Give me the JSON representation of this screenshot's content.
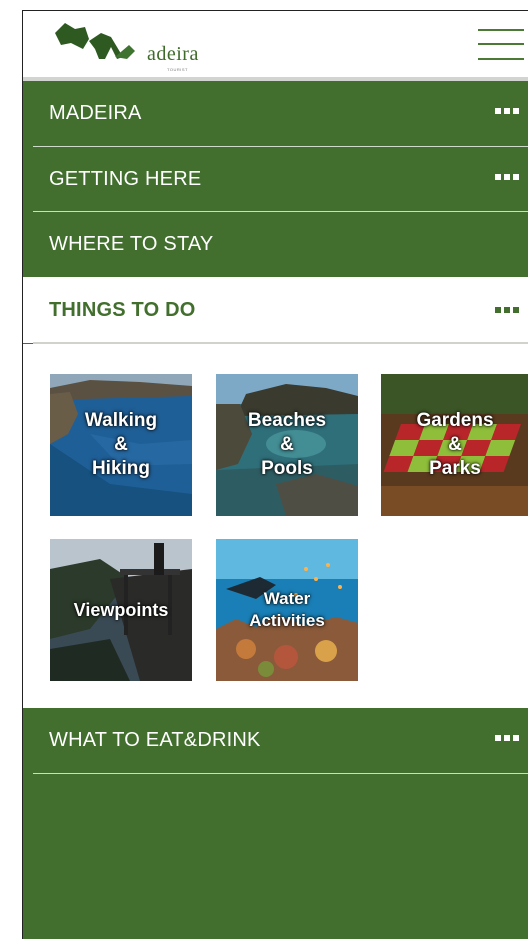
{
  "header": {
    "logo_text": "adeira",
    "logo_subtext": "TOURIST",
    "menu_icon": "hamburger-menu-icon"
  },
  "menu": {
    "madeira": "MADEIRA",
    "getting_here": "GETTING HERE",
    "where_to_stay": "WHERE TO STAY",
    "things_to_do": "THINGS TO DO",
    "what_to_eat": "WHAT TO EAT&DRINK"
  },
  "activities": [
    {
      "label": "Walking\n&\nHiking"
    },
    {
      "label": "Beaches\n&\nPools"
    },
    {
      "label": "Gardens\n&\nParks"
    },
    {
      "label": "Viewpoints"
    },
    {
      "label": "Water\nActivities"
    }
  ],
  "colors": {
    "brand_green": "#426f2e",
    "text_white": "#ffffff"
  }
}
